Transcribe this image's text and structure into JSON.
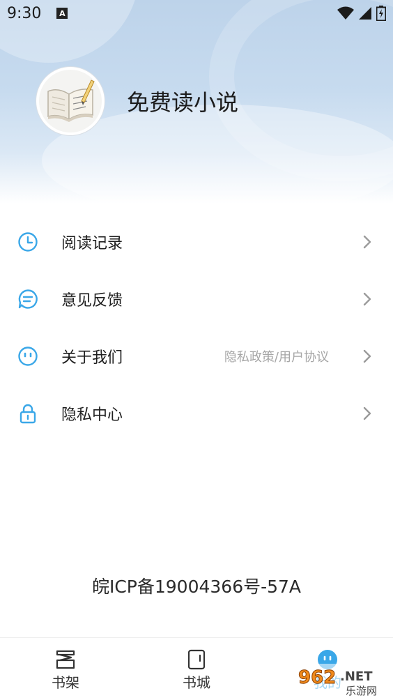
{
  "status_bar": {
    "time": "9:30",
    "notification_icon": "A"
  },
  "profile": {
    "app_name": "免费读小说"
  },
  "menu": {
    "items": [
      {
        "icon": "clock-icon",
        "label": "阅读记录",
        "extra": ""
      },
      {
        "icon": "chat-icon",
        "label": "意见反馈",
        "extra": ""
      },
      {
        "icon": "smiley-icon",
        "label": "关于我们",
        "extra": "隐私政策/用户协议"
      },
      {
        "icon": "lock-icon",
        "label": "隐私中心",
        "extra": ""
      }
    ]
  },
  "footer": {
    "icp": "皖ICP备19004366号-57A"
  },
  "bottom_nav": {
    "items": [
      {
        "icon": "bookshelf-icon",
        "label": "书架"
      },
      {
        "icon": "bookstore-icon",
        "label": "书城"
      },
      {
        "icon": "profile-icon",
        "label": "我的"
      }
    ]
  },
  "watermark": {
    "text_main": "962",
    "text_suffix": ".NET",
    "text_sub": "乐游网"
  },
  "colors": {
    "accent": "#3aa7e8",
    "chevron": "#9a9a9a"
  }
}
